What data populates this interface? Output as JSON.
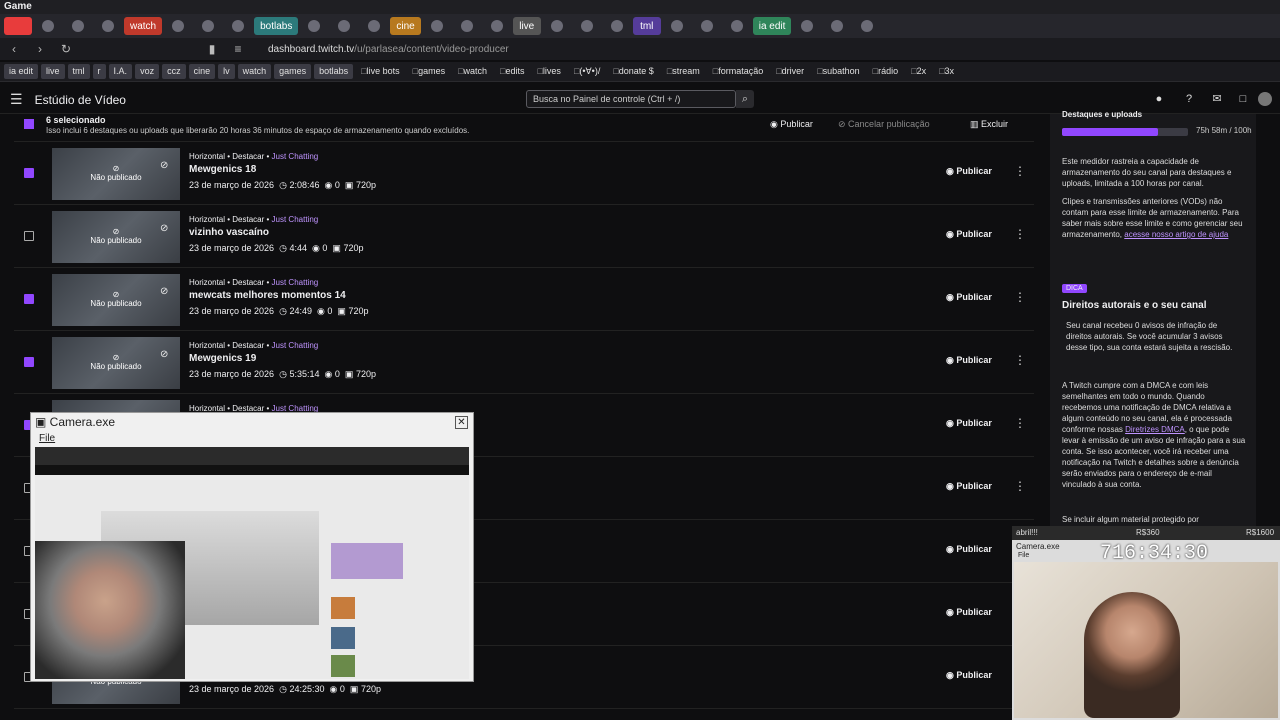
{
  "window": {
    "title": "Game"
  },
  "tabs": [
    {
      "label": "",
      "color": "#e83c3c"
    },
    {
      "label": "watch",
      "color": "#c0392b"
    },
    {
      "label": "botlabs",
      "color": "#2c7a7b"
    },
    {
      "label": "cine",
      "color": "#b7791f"
    },
    {
      "label": "live",
      "color": "#555555"
    },
    {
      "label": "tml",
      "color": "#553c9a"
    },
    {
      "label": "ia edit",
      "color": "#2f855a"
    }
  ],
  "urlbar": {
    "host": "dashboard.twitch.tv",
    "path": "/u/parlasea/content/video-producer"
  },
  "bookmarks": [
    "ia edit",
    "live",
    "tml",
    "r",
    "I.A.",
    "voz",
    "ccz",
    "cine",
    "lv",
    "watch",
    "games",
    "botlabs",
    "live bots",
    "games",
    "watch",
    "edits",
    "lives",
    "(•∀•)/",
    "donate $",
    "stream",
    "formatação",
    "driver",
    "subathon",
    "rádio",
    "2x",
    "3x"
  ],
  "header": {
    "studio_title": "Estúdio de Vídeo",
    "search_placeholder": "Busca no Painel de controle (Ctrl + /)"
  },
  "selection": {
    "title": "6 selecionado",
    "subtitle": "Isso inclui 6 destaques ou uploads que liberarão 20 horas 36 minutos de espaço de armazenamento quando excluídos.",
    "publish": "Publicar",
    "unpublish": "Cancelar publicação",
    "delete": "Excluir"
  },
  "videos": [
    {
      "meta": "Horizontal • Destacar • ",
      "category": "Just Chatting",
      "title": "Mewgenics 18",
      "date": "23 de março de 2026",
      "duration": "2:08:46",
      "views": "0",
      "quality": "720p",
      "status": "Não publicado",
      "checked": true,
      "action": "Publicar"
    },
    {
      "meta": "Horizontal • Destacar • ",
      "category": "Just Chatting",
      "title": "vizinho vascaíno",
      "date": "23 de março de 2026",
      "duration": "4:44",
      "views": "0",
      "quality": "720p",
      "status": "Não publicado",
      "checked": false,
      "action": "Publicar"
    },
    {
      "meta": "Horizontal • Destacar • ",
      "category": "Just Chatting",
      "title": "mewcats melhores momentos 14",
      "date": "23 de março de 2026",
      "duration": "24:49",
      "views": "0",
      "quality": "720p",
      "status": "Não publicado",
      "checked": true,
      "action": "Publicar"
    },
    {
      "meta": "Horizontal • Destacar • ",
      "category": "Just Chatting",
      "title": "Mewgenics 19",
      "date": "23 de março de 2026",
      "duration": "5:35:14",
      "views": "0",
      "quality": "720p",
      "status": "Não publicado",
      "checked": true,
      "action": "Publicar"
    },
    {
      "meta": "Horizontal • Destacar • ",
      "category": "Just Chatting",
      "title": "",
      "date": "",
      "duration": "",
      "views": "",
      "quality": "",
      "status": "",
      "checked": true,
      "action": "Publicar"
    },
    {
      "meta": "",
      "category": "",
      "title": "",
      "date": "",
      "duration": "",
      "views": "",
      "quality": "",
      "status": "",
      "checked": false,
      "action": "Publicar"
    },
    {
      "meta": "",
      "category": "",
      "title": "",
      "date": "",
      "duration": "",
      "views": "",
      "quality": "",
      "status": "",
      "checked": false,
      "action": "Publicar"
    },
    {
      "meta": "",
      "category": "",
      "title": "",
      "date": "",
      "duration": "",
      "views": "",
      "quality": "",
      "status": "",
      "checked": false,
      "action": "Publicar"
    },
    {
      "meta": "",
      "category": "",
      "title": "",
      "date": "23 de março de 2026",
      "duration": "24:25:30",
      "views": "0",
      "quality": "720p",
      "status": "Não publicado",
      "checked": false,
      "action": "Publicar"
    }
  ],
  "storage": {
    "label": "Destaques e uploads",
    "value": "75h 58m / 100h",
    "fraction": 0.76,
    "desc1": "Este medidor rastreia a capacidade de armazenamento do seu canal para destaques e uploads, limitada a 100 horas por canal.",
    "desc2": "Clipes e transmissões anteriores (VODs) não contam para esse limite de armazenamento. Para saber mais sobre esse limite e como gerenciar seu armazenamento,",
    "link": "acesse nosso artigo de ajuda"
  },
  "tip": {
    "badge": "DICA",
    "title": "Direitos autorais e o seu canal",
    "p1": "Seu canal recebeu 0 avisos de infração de direitos autorais. Se você acumular 3 avisos desse tipo, sua conta estará sujeita a rescisão.",
    "p2": "A Twitch cumpre com a DMCA e com leis semelhantes em todo o mundo. Quando recebemos uma notificação de DMCA relativa a algum conteúdo no seu canal, ela é processada conforme nossas",
    "p2_link": "Diretrizes DMCA",
    "p2_rest": ", o que pode levar à emissão de um aviso de infração para a sua conta. Se isso acontecer, você irá receber uma notificação na Twitch e detalhes sobre a denúncia serão enviados para o endereço de e-mail vinculado à sua conta.",
    "p3": "Se incluir algum material protegido por"
  },
  "camera": {
    "title": "Camera.exe",
    "menu": "File"
  },
  "timer": {
    "top_left": "abril!!!",
    "top_mid": "R$360",
    "top_right": "R$1600",
    "title": "Camera.exe",
    "menu": "File",
    "value": "716:34:30"
  }
}
